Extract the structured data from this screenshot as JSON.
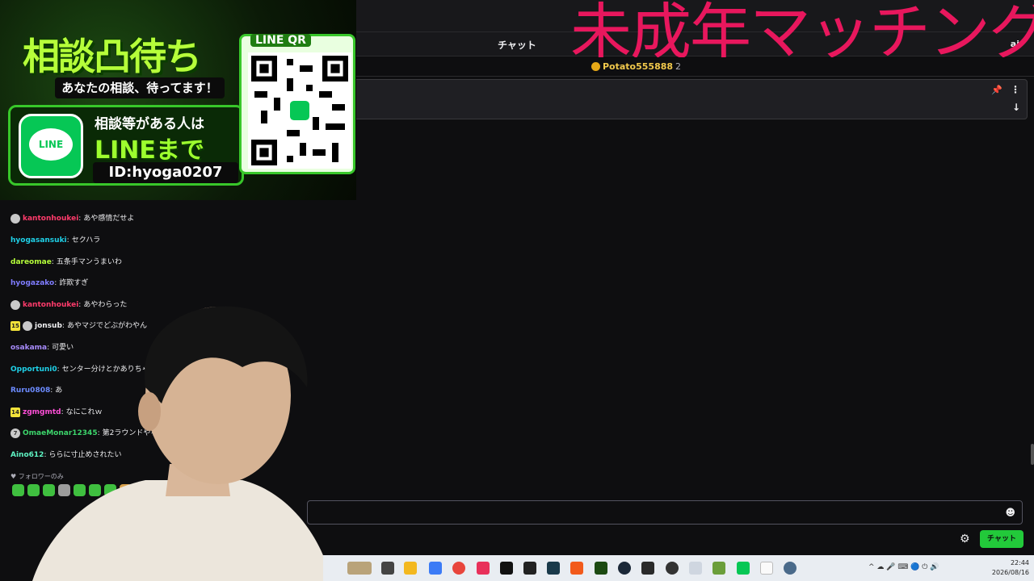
{
  "overlay": {
    "title": "未成年マッチング"
  },
  "header": {
    "title": "チャット",
    "icon": "users-icon"
  },
  "leaderboard": {
    "user": "Potato555888",
    "count": "2"
  },
  "promo": {
    "title": "相談凸待ち",
    "subtitle": "あなたの相談、待ってます！",
    "ask": "相談等がある人は",
    "line_text": "LINEまで",
    "line_id": "ID:hyoga0207",
    "qr_label": "LINE QR",
    "logo_text": "LINE"
  },
  "chat": {
    "messages": [
      {
        "badges": [
          "gray"
        ],
        "user": "kantonhoukei",
        "color": "#ff3b6b",
        "text": "あや感情だせよ"
      },
      {
        "badges": [],
        "user": "hyogasansuki",
        "color": "#1fd1e8",
        "text": "セクハラ"
      },
      {
        "badges": [],
        "user": "dareomae",
        "color": "#b6ff3a",
        "text": "五条手マンうまいわ"
      },
      {
        "badges": [],
        "user": "hyogazako",
        "color": "#7f7cff",
        "text": "詐欺すぎ"
      },
      {
        "badges": [
          "gray"
        ],
        "user": "kantonhoukei",
        "color": "#ff3b6b",
        "text": "あやわらった"
      },
      {
        "badges": [
          "15",
          "gray"
        ],
        "user": "jonsub",
        "color": "#efeff1",
        "text": "あやマジでどぶがわやん"
      },
      {
        "badges": [],
        "user": "osakama",
        "color": "#a78bfa",
        "text": "可愛い"
      },
      {
        "badges": [],
        "user": "Opportuni0",
        "color": "#1fd1e8",
        "text": "センター分けとかありちゃう"
      },
      {
        "badges": [],
        "user": "Ruru0808",
        "color": "#6c8bff",
        "text": "あ"
      },
      {
        "badges": [
          "14"
        ],
        "user": "zgmgmtd",
        "color": "#ff4fd8",
        "text": "なにこれｗ"
      },
      {
        "badges": [
          "7"
        ],
        "user": "OmaeMonar12345",
        "color": "#3cd56b",
        "text": "第2ラウンドやろ"
      },
      {
        "badges": [],
        "user": "Aino612",
        "color": "#5ef2c2",
        "text": "ららに寸止めされたい"
      }
    ],
    "follower_note": "♥ フォロワーのみ",
    "send_label": "チャット",
    "emote_icon": "smile-icon",
    "settings_icon": "gear-icon"
  },
  "taskbar": {
    "time": "22:44",
    "date": "2026/08/16"
  }
}
